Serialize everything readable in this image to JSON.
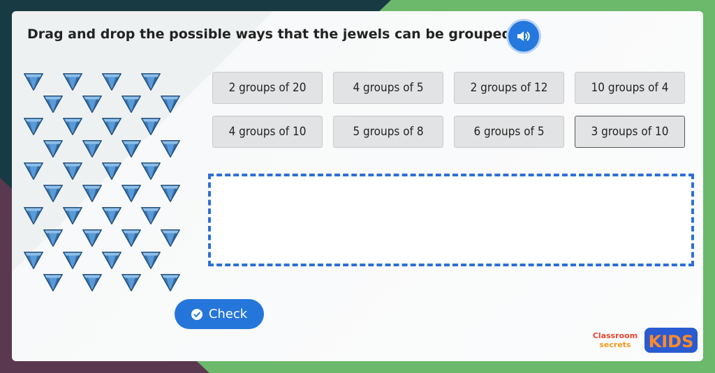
{
  "instruction": "Drag and drop the possible ways that the jewels can be grouped.",
  "sound_button": {
    "icon": "speaker-icon"
  },
  "jewels": {
    "count": 40,
    "icon": "diamond-gem-icon",
    "color": "#4f8fc9"
  },
  "options": [
    {
      "label": "2 groups of 20"
    },
    {
      "label": "4 groups of 5"
    },
    {
      "label": "2 groups of 12"
    },
    {
      "label": "10 groups of 4"
    },
    {
      "label": "4 groups of 10"
    },
    {
      "label": "5 groups of 8"
    },
    {
      "label": "6 groups of 5"
    },
    {
      "label": "3 groups of 10"
    }
  ],
  "check_button": {
    "label": "Check",
    "icon": "check-circle-icon"
  },
  "logo": {
    "text_top": "Classroom",
    "text_bottom": "secrets",
    "kids": "KIDS"
  },
  "colors": {
    "accent_blue": "#2576db",
    "dropzone_border": "#2d6fd6",
    "bg_green": "#6cb96b",
    "bg_dark": "#173a43",
    "bg_purple": "#5a3950"
  }
}
